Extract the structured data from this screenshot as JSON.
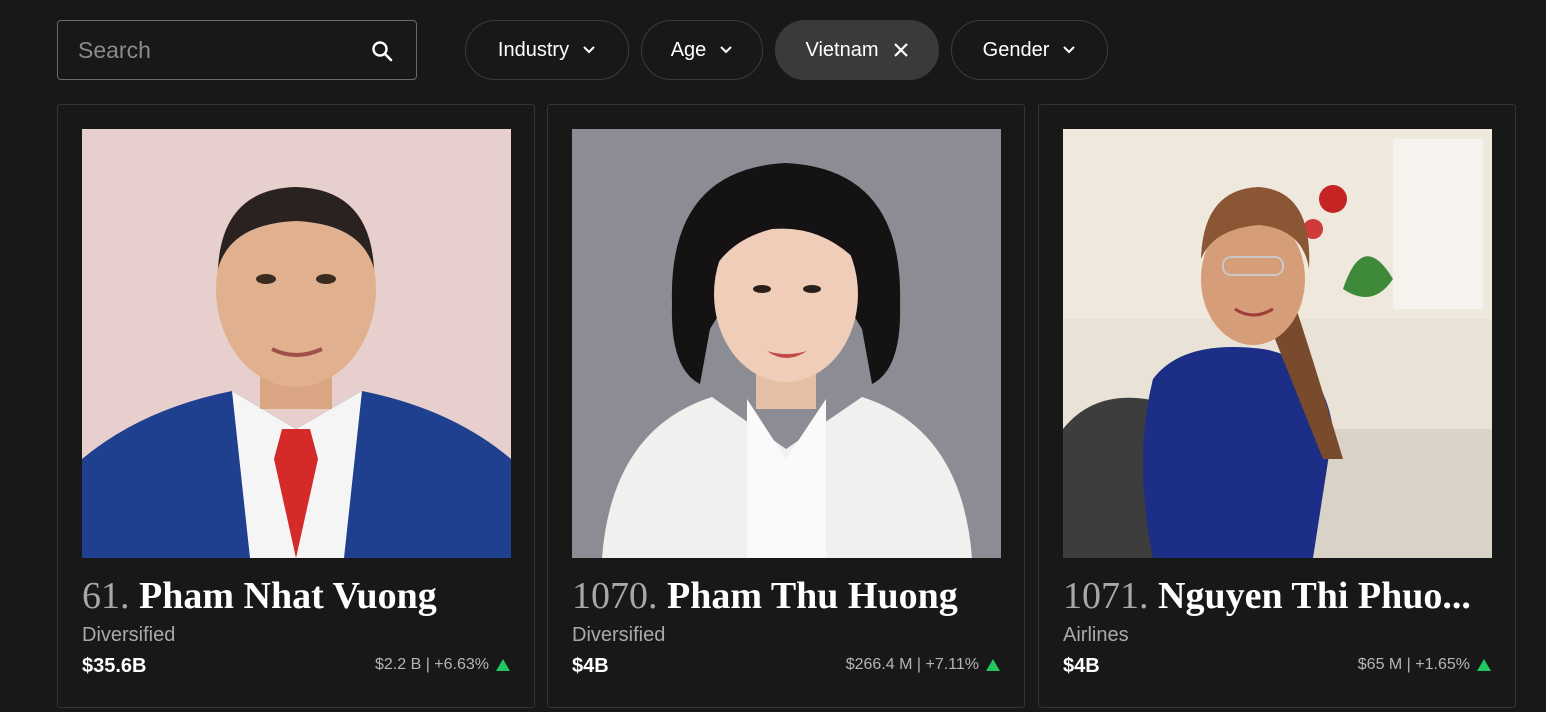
{
  "search": {
    "placeholder": "Search",
    "value": ""
  },
  "filters": [
    {
      "label": "Industry",
      "icon": "chevron-down-icon"
    },
    {
      "label": "Age",
      "icon": "chevron-down-icon"
    },
    {
      "label": "Vietnam",
      "icon": "close-icon",
      "active": true
    },
    {
      "label": "Gender",
      "icon": "chevron-down-icon"
    }
  ],
  "cards": [
    {
      "rank": "61.",
      "name": "Pham Nhat Vuong",
      "industry": "Diversified",
      "net_worth": "$35.6B",
      "change": "$2.2 B | +6.63%",
      "trend": "up"
    },
    {
      "rank": "1070.",
      "name": "Pham Thu Huong",
      "industry": "Diversified",
      "net_worth": "$4B",
      "change": "$266.4 M | +7.11%",
      "trend": "up"
    },
    {
      "rank": "1071.",
      "name": "Nguyen Thi Phuo...",
      "industry": "Airlines",
      "net_worth": "$4B",
      "change": "$65 M | +1.65%",
      "trend": "up"
    }
  ],
  "colors": {
    "background": "#181818",
    "up": "#22c55e",
    "muted": "#a9a9a9"
  }
}
